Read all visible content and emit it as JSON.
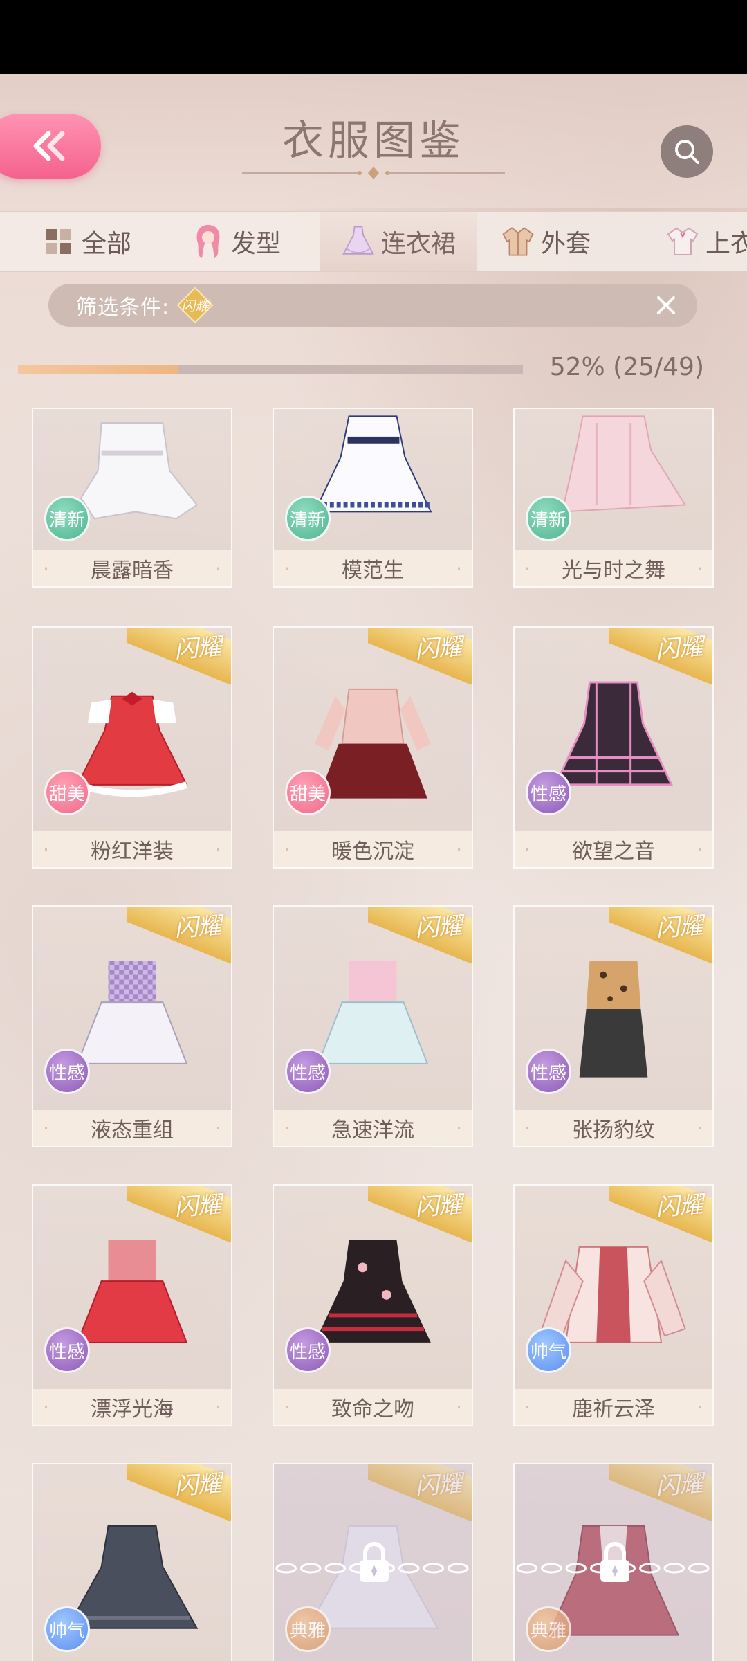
{
  "header": {
    "title": "衣服图鉴"
  },
  "tabs": [
    {
      "label": "全部",
      "icon": "grid-icon",
      "active": false
    },
    {
      "label": "发型",
      "icon": "hair-icon",
      "active": false
    },
    {
      "label": "连衣裙",
      "icon": "dress-icon",
      "active": true
    },
    {
      "label": "外套",
      "icon": "coat-icon",
      "active": false
    },
    {
      "label": "上衣",
      "icon": "top-icon",
      "active": false
    }
  ],
  "filter": {
    "label": "筛选条件:",
    "chip": "闪耀"
  },
  "progress": {
    "percent": 52,
    "text": "52% (25/49)"
  },
  "shine_label": "闪耀",
  "items": [
    {
      "name": "晨露暗香",
      "tag": "清新",
      "style": "fresh",
      "shine": false,
      "locked": false
    },
    {
      "name": "模范生",
      "tag": "清新",
      "style": "fresh",
      "shine": false,
      "locked": false
    },
    {
      "name": "光与时之舞",
      "tag": "清新",
      "style": "fresh",
      "shine": false,
      "locked": false
    },
    {
      "name": "粉红洋装",
      "tag": "甜美",
      "style": "sweet",
      "shine": true,
      "locked": false
    },
    {
      "name": "暖色沉淀",
      "tag": "甜美",
      "style": "sweet",
      "shine": true,
      "locked": false
    },
    {
      "name": "欲望之音",
      "tag": "性感",
      "style": "sexy",
      "shine": true,
      "locked": false
    },
    {
      "name": "液态重组",
      "tag": "性感",
      "style": "sexy",
      "shine": true,
      "locked": false
    },
    {
      "name": "急速洋流",
      "tag": "性感",
      "style": "sexy",
      "shine": true,
      "locked": false
    },
    {
      "name": "张扬豹纹",
      "tag": "性感",
      "style": "sexy",
      "shine": true,
      "locked": false
    },
    {
      "name": "漂浮光海",
      "tag": "性感",
      "style": "sexy",
      "shine": true,
      "locked": false
    },
    {
      "name": "致命之吻",
      "tag": "性感",
      "style": "sexy",
      "shine": true,
      "locked": false
    },
    {
      "name": "鹿祈云泽",
      "tag": "帅气",
      "style": "cool",
      "shine": true,
      "locked": false
    },
    {
      "name": "",
      "tag": "帅气",
      "style": "cool",
      "shine": true,
      "locked": false
    },
    {
      "name": "",
      "tag": "典雅",
      "style": "elegant",
      "shine": true,
      "locked": true
    },
    {
      "name": "",
      "tag": "典雅",
      "style": "elegant",
      "shine": true,
      "locked": true
    }
  ]
}
